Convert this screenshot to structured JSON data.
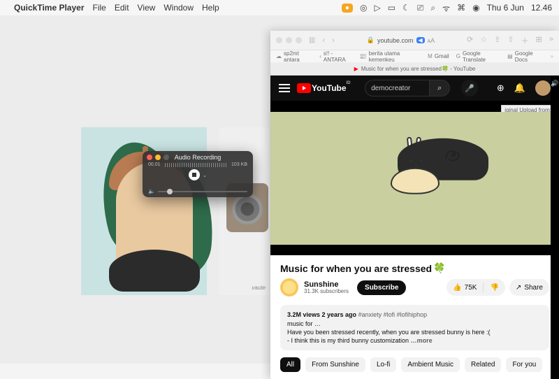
{
  "menubar": {
    "app": "QuickTime Player",
    "items": [
      "File",
      "Edit",
      "View",
      "Window",
      "Help"
    ],
    "date": "Thu 6 Jun",
    "time": "12.46"
  },
  "quicktime": {
    "title": "Audio Recording",
    "elapsed": "00.01",
    "size": "103 KB"
  },
  "gallery_caption": "vaute",
  "safari": {
    "domain": "youtube.com",
    "audio_badge": "◀︎",
    "bookmarks": [
      {
        "icon": "☁︎",
        "label": "sp2mt antara"
      },
      {
        "icon": "‹",
        "label": "s!! - ANTARA"
      },
      {
        "icon": "📰",
        "label": "berita utama kemenkeu"
      },
      {
        "icon": "M",
        "label": "Gmail"
      },
      {
        "icon": "G",
        "label": "Google Translate"
      },
      {
        "icon": "▤",
        "label": "Google Docs"
      }
    ],
    "tab_label": "Music for when you are stressed🍀 - YouTube"
  },
  "youtube": {
    "brand": "YouTube",
    "search_value": "democreator",
    "tooltip": "iginal Upload from:",
    "video_title": "Music for when you are stressed",
    "channel_name": "Sunshine",
    "channel_subs": "31.3K subscribers",
    "subscribe_label": "Subscribe",
    "likes": "75K",
    "share_label": "Share",
    "desc_stats": "3.2M views  2 years ago",
    "desc_tags": "#anxiety #lofi #lofihiphop",
    "desc_body1": "music for …",
    "desc_body2": "Have you been stressed recently, when you are stressed bunny is here :(",
    "desc_body3": "- I think this is my third bunny customization",
    "more_label": "…more",
    "chips": [
      "All",
      "From Sunshine",
      "Lo-fi",
      "Ambient Music",
      "Related",
      "For you"
    ]
  }
}
